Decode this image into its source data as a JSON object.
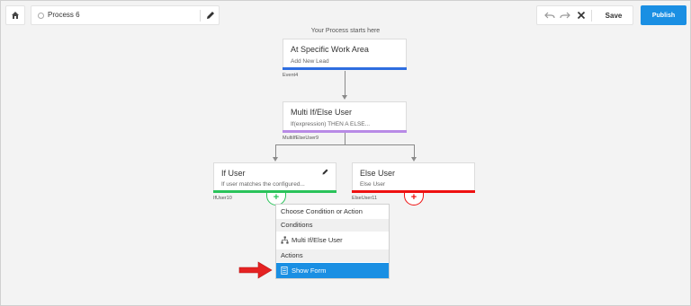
{
  "header": {
    "process_name": "Process 6",
    "save_label": "Save",
    "publish_label": "Publish"
  },
  "canvas": {
    "start_label": "Your Process starts here"
  },
  "nodes": {
    "start": {
      "title": "At Specific Work Area",
      "subtitle": "Add New Lead",
      "id": "Event4",
      "color": "#2e6de0"
    },
    "multi": {
      "title": "Multi If/Else User",
      "subtitle": "If(expression) THEN A  ELSE...",
      "id": "MultiIfElseUser9",
      "color": "#b88ae6"
    },
    "if_user": {
      "title": "If User",
      "subtitle": "If user matches the configured...",
      "id": "IfUser10",
      "color": "#2ac35a"
    },
    "else_user": {
      "title": "Else User",
      "subtitle": "Else User",
      "id": "ElseUser11",
      "color": "#ee1111"
    }
  },
  "menu": {
    "heading": "Choose Condition or Action",
    "conditions_label": "Conditions",
    "condition_item": "Multi If/Else User",
    "actions_label": "Actions",
    "action_item": "Show Form"
  },
  "icons": [
    "home-icon",
    "pencil-icon",
    "undo-icon",
    "redo-icon",
    "close-icon",
    "hierarchy-icon",
    "form-icon",
    "plus-icon",
    "arrow-icon"
  ]
}
